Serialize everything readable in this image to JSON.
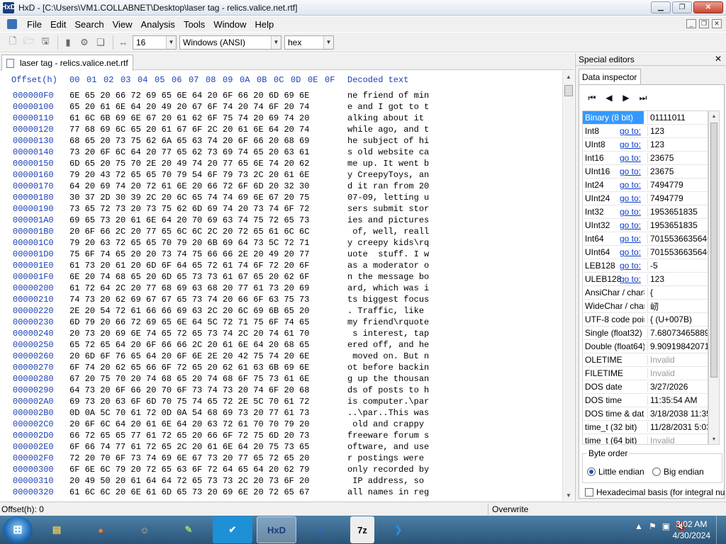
{
  "window": {
    "title": "HxD - [C:\\Users\\VM1.COLLABNET\\Desktop\\laser tag - relics.valice.net.rtf]",
    "app_icon": "HxD"
  },
  "menu": [
    "File",
    "Edit",
    "Search",
    "View",
    "Analysis",
    "Tools",
    "Window",
    "Help"
  ],
  "toolbar": {
    "bytes_per_row": "16",
    "charset": "Windows (ANSI)",
    "display_mode": "hex"
  },
  "document_tab": {
    "label": "laser tag - relics.valice.net.rtf"
  },
  "hex": {
    "header_offset": "Offset(h)",
    "columns": [
      "00",
      "01",
      "02",
      "03",
      "04",
      "05",
      "06",
      "07",
      "08",
      "09",
      "0A",
      "0B",
      "0C",
      "0D",
      "0E",
      "0F"
    ],
    "header_decoded": "Decoded text",
    "rows": [
      {
        "offset": "000000F0",
        "hex": "6E 65 20 66 72 69 65 6E 64 20 6F 66 20 6D 69 6E",
        "text": "ne friend of min"
      },
      {
        "offset": "00000100",
        "hex": "65 20 61 6E 64 20 49 20 67 6F 74 20 74 6F 20 74",
        "text": "e and I got to t"
      },
      {
        "offset": "00000110",
        "hex": "61 6C 6B 69 6E 67 20 61 62 6F 75 74 20 69 74 20",
        "text": "alking about it "
      },
      {
        "offset": "00000120",
        "hex": "77 68 69 6C 65 20 61 67 6F 2C 20 61 6E 64 20 74",
        "text": "while ago, and t"
      },
      {
        "offset": "00000130",
        "hex": "68 65 20 73 75 62 6A 65 63 74 20 6F 66 20 68 69",
        "text": "he subject of hi"
      },
      {
        "offset": "00000140",
        "hex": "73 20 6F 6C 64 20 77 65 62 73 69 74 65 20 63 61",
        "text": "s old website ca"
      },
      {
        "offset": "00000150",
        "hex": "6D 65 20 75 70 2E 20 49 74 20 77 65 6E 74 20 62",
        "text": "me up. It went b"
      },
      {
        "offset": "00000160",
        "hex": "79 20 43 72 65 65 70 79 54 6F 79 73 2C 20 61 6E",
        "text": "y CreepyToys, an"
      },
      {
        "offset": "00000170",
        "hex": "64 20 69 74 20 72 61 6E 20 66 72 6F 6D 20 32 30",
        "text": "d it ran from 20"
      },
      {
        "offset": "00000180",
        "hex": "30 37 2D 30 39 2C 20 6C 65 74 74 69 6E 67 20 75",
        "text": "07-09, letting u"
      },
      {
        "offset": "00000190",
        "hex": "73 65 72 73 20 73 75 62 6D 69 74 20 73 74 6F 72",
        "text": "sers submit stor"
      },
      {
        "offset": "000001A0",
        "hex": "69 65 73 20 61 6E 64 20 70 69 63 74 75 72 65 73",
        "text": "ies and pictures"
      },
      {
        "offset": "000001B0",
        "hex": "20 6F 66 2C 20 77 65 6C 6C 2C 20 72 65 61 6C 6C",
        "text": " of, well, reall"
      },
      {
        "offset": "000001C0",
        "hex": "79 20 63 72 65 65 70 79 20 6B 69 64 73 5C 72 71",
        "text": "y creepy kids\\rq"
      },
      {
        "offset": "000001D0",
        "hex": "75 6F 74 65 20 20 73 74 75 66 66 2E 20 49 20 77",
        "text": "uote  stuff. I w"
      },
      {
        "offset": "000001E0",
        "hex": "61 73 20 61 20 6D 6F 64 65 72 61 74 6F 72 20 6F",
        "text": "as a moderator o"
      },
      {
        "offset": "000001F0",
        "hex": "6E 20 74 68 65 20 6D 65 73 73 61 67 65 20 62 6F",
        "text": "n the message bo"
      },
      {
        "offset": "00000200",
        "hex": "61 72 64 2C 20 77 68 69 63 68 20 77 61 73 20 69",
        "text": "ard, which was i"
      },
      {
        "offset": "00000210",
        "hex": "74 73 20 62 69 67 67 65 73 74 20 66 6F 63 75 73",
        "text": "ts biggest focus"
      },
      {
        "offset": "00000220",
        "hex": "2E 20 54 72 61 66 66 69 63 2C 20 6C 69 6B 65 20",
        "text": ". Traffic, like "
      },
      {
        "offset": "00000230",
        "hex": "6D 79 20 66 72 69 65 6E 64 5C 72 71 75 6F 74 65",
        "text": "my friend\\rquote"
      },
      {
        "offset": "00000240",
        "hex": "20 73 20 69 6E 74 65 72 65 73 74 2C 20 74 61 70",
        "text": " s interest, tap"
      },
      {
        "offset": "00000250",
        "hex": "65 72 65 64 20 6F 66 66 2C 20 61 6E 64 20 68 65",
        "text": "ered off, and he"
      },
      {
        "offset": "00000260",
        "hex": "20 6D 6F 76 65 64 20 6F 6E 2E 20 42 75 74 20 6E",
        "text": " moved on. But n"
      },
      {
        "offset": "00000270",
        "hex": "6F 74 20 62 65 66 6F 72 65 20 62 61 63 6B 69 6E",
        "text": "ot before backin"
      },
      {
        "offset": "00000280",
        "hex": "67 20 75 70 20 74 68 65 20 74 68 6F 75 73 61 6E",
        "text": "g up the thousan"
      },
      {
        "offset": "00000290",
        "hex": "64 73 20 6F 66 20 70 6F 73 74 73 20 74 6F 20 68",
        "text": "ds of posts to h"
      },
      {
        "offset": "000002A0",
        "hex": "69 73 20 63 6F 6D 70 75 74 65 72 2E 5C 70 61 72",
        "text": "is computer.\\par"
      },
      {
        "offset": "000002B0",
        "hex": "0D 0A 5C 70 61 72 0D 0A 54 68 69 73 20 77 61 73",
        "text": "..\\par..This was"
      },
      {
        "offset": "000002C0",
        "hex": "20 6F 6C 64 20 61 6E 64 20 63 72 61 70 70 79 20",
        "text": " old and crappy "
      },
      {
        "offset": "000002D0",
        "hex": "66 72 65 65 77 61 72 65 20 66 6F 72 75 6D 20 73",
        "text": "freeware forum s"
      },
      {
        "offset": "000002E0",
        "hex": "6F 66 74 77 61 72 65 2C 20 61 6E 64 20 75 73 65",
        "text": "oftware, and use"
      },
      {
        "offset": "000002F0",
        "hex": "72 20 70 6F 73 74 69 6E 67 73 20 77 65 72 65 20",
        "text": "r postings were "
      },
      {
        "offset": "00000300",
        "hex": "6F 6E 6C 79 20 72 65 63 6F 72 64 65 64 20 62 79",
        "text": "only recorded by"
      },
      {
        "offset": "00000310",
        "hex": "20 49 50 20 61 64 64 72 65 73 73 2C 20 73 6F 20",
        "text": " IP address, so "
      },
      {
        "offset": "00000320",
        "hex": "61 6C 6C 20 6E 61 6D 65 73 20 69 6E 20 72 65 67",
        "text": "all names in reg"
      }
    ]
  },
  "special_editors": {
    "title": "Special editors",
    "close_glyph": "✕",
    "tab": "Data inspector",
    "goto_label": "go to:",
    "rows": [
      {
        "name": "Binary (8 bit)",
        "goto": false,
        "value": "01111011",
        "selected": true,
        "grey": false
      },
      {
        "name": "Int8",
        "goto": true,
        "value": "123",
        "grey": false
      },
      {
        "name": "UInt8",
        "goto": true,
        "value": "123",
        "grey": false
      },
      {
        "name": "Int16",
        "goto": true,
        "value": "23675",
        "grey": false
      },
      {
        "name": "UInt16",
        "goto": true,
        "value": "23675",
        "grey": false
      },
      {
        "name": "Int24",
        "goto": true,
        "value": "7494779",
        "grey": false
      },
      {
        "name": "UInt24",
        "goto": true,
        "value": "7494779",
        "grey": false
      },
      {
        "name": "Int32",
        "goto": true,
        "value": "1953651835",
        "grey": false
      },
      {
        "name": "UInt32",
        "goto": true,
        "value": "1953651835",
        "grey": false
      },
      {
        "name": "Int64",
        "goto": true,
        "value": "70155366356464",
        "grey": false
      },
      {
        "name": "UInt64",
        "goto": true,
        "value": "70155366356464",
        "grey": false
      },
      {
        "name": "LEB128",
        "goto": true,
        "value": "-5",
        "grey": false
      },
      {
        "name": "ULEB128",
        "goto": true,
        "value": "123",
        "grey": false
      },
      {
        "name": "AnsiChar / char8_t",
        "goto": false,
        "value": "{",
        "grey": false
      },
      {
        "name": "WideChar / char16_t",
        "goto": false,
        "value": "屻",
        "grey": false
      },
      {
        "name": "UTF-8 code point",
        "goto": false,
        "value": "{ (U+007B)",
        "grey": false
      },
      {
        "name": "Single (float32)",
        "goto": false,
        "value": "7.68073465889",
        "grey": false
      },
      {
        "name": "Double (float64)",
        "goto": false,
        "value": "9.90919842071",
        "grey": false
      },
      {
        "name": "OLETIME",
        "goto": false,
        "value": "Invalid",
        "grey": true
      },
      {
        "name": "FILETIME",
        "goto": false,
        "value": "Invalid",
        "grey": true
      },
      {
        "name": "DOS date",
        "goto": false,
        "value": "3/27/2026",
        "grey": false
      },
      {
        "name": "DOS time",
        "goto": false,
        "value": "11:35:54 AM",
        "grey": false
      },
      {
        "name": "DOS time & date",
        "goto": false,
        "value": "3/18/2038 11:35",
        "grey": false
      },
      {
        "name": "time_t (32 bit)",
        "goto": false,
        "value": "11/28/2031 5:03",
        "grey": false
      },
      {
        "name": "time_t (64 bit)",
        "goto": false,
        "value": "Invalid",
        "grey": true
      }
    ],
    "byte_order": {
      "legend": "Byte order",
      "little_endian": "Little endian",
      "big_endian": "Big endian",
      "selected": "little"
    },
    "hex_basis": "Hexadecimal basis (for integral nu"
  },
  "status": {
    "offset": "Offset(h): 0",
    "mode": "Overwrite"
  },
  "taskbar": {
    "items": [
      "Explorer",
      "Firefox",
      "Portrait",
      "Notepad",
      "Tasks",
      "HxD",
      "Link",
      "7z",
      "VS Code"
    ],
    "active": "HxD",
    "clock_time": "3:02 AM",
    "clock_date": "4/30/2024"
  },
  "colors": {
    "offset_blue": "#1a3fb5",
    "selection_blue": "#3399ff",
    "link_blue": "#0a3cc8",
    "taskbar": "#2a5478"
  }
}
